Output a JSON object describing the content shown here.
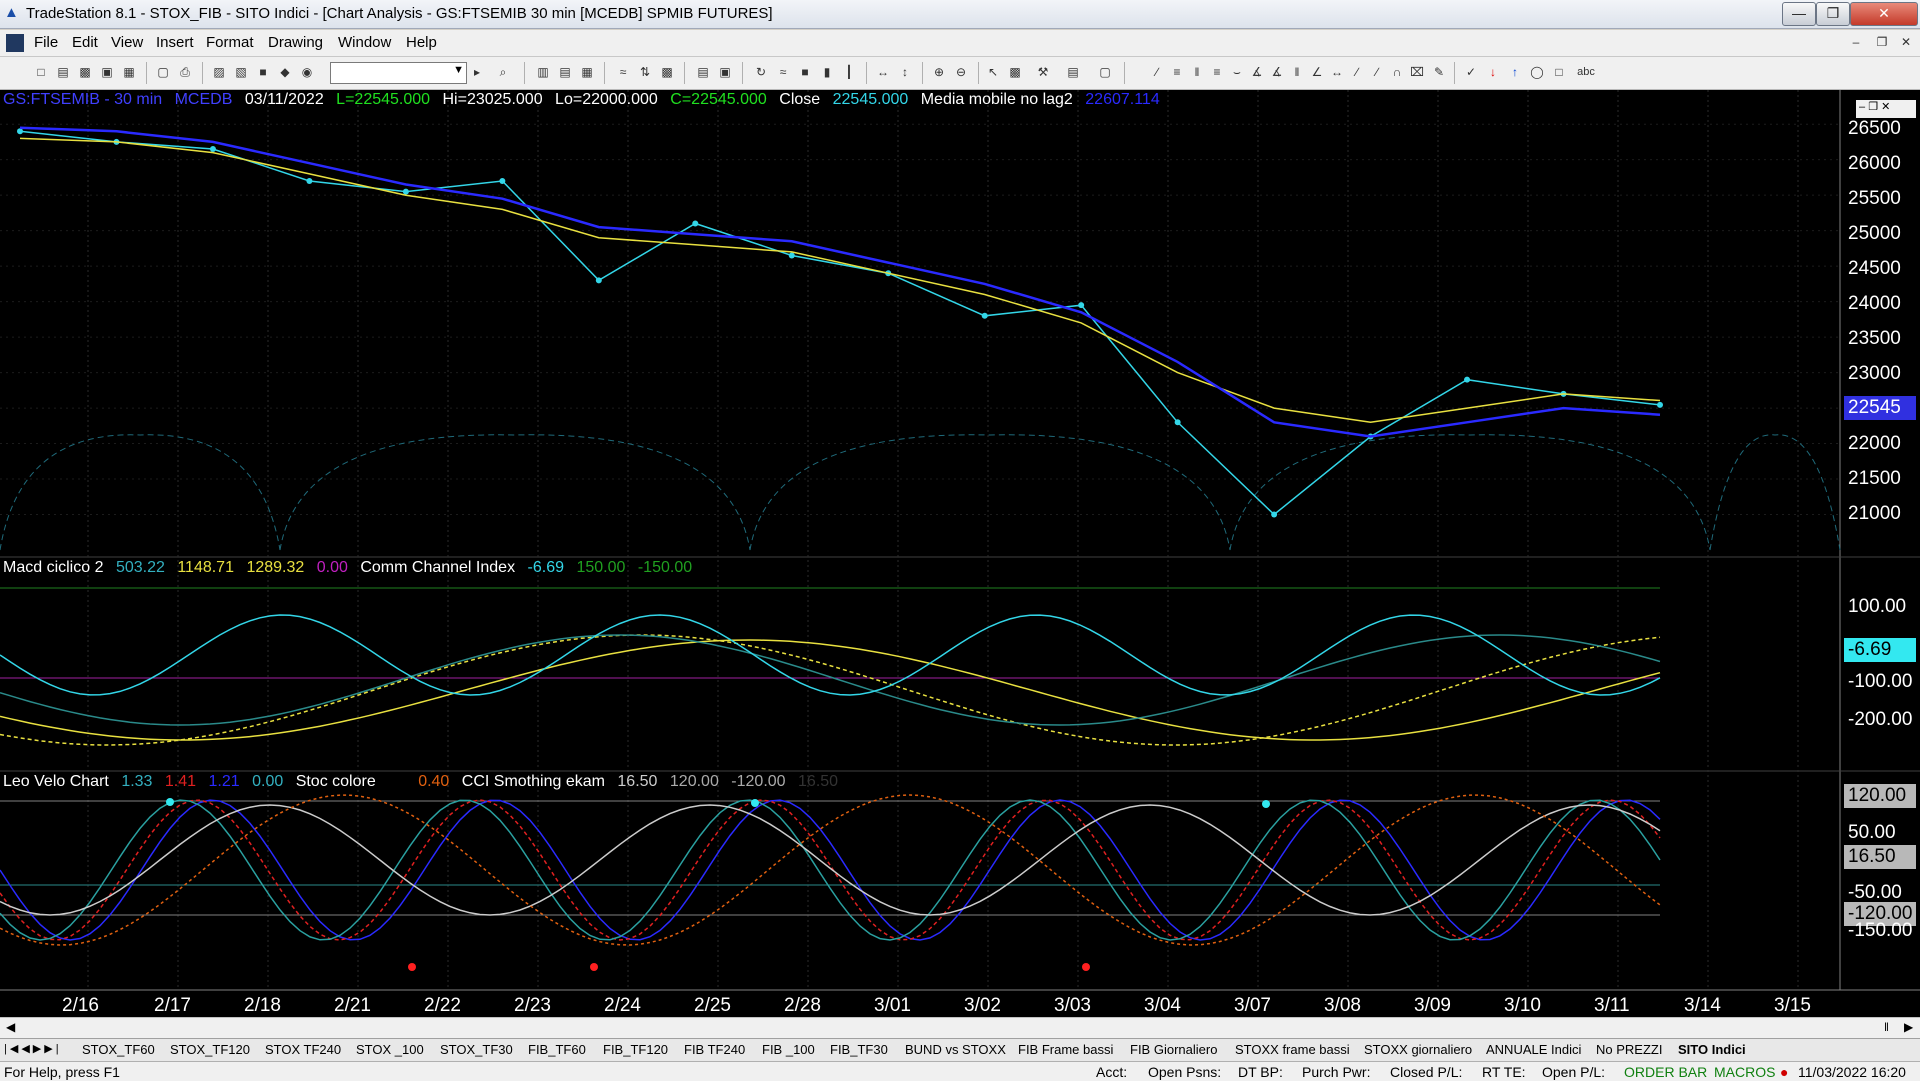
{
  "window": {
    "title": "TradeStation 8.1 - STOX_FIB - SITO Indici - [Chart Analysis - GS:FTSEMIB  30 min  [MCEDB] SPMIB FUTURES]"
  },
  "menu": [
    "File",
    "Edit",
    "View",
    "Insert",
    "Format",
    "Drawing",
    "Window",
    "Help"
  ],
  "toolbar": {
    "combo_value": ""
  },
  "price_legend": {
    "symbol": "GS:FTSEMIB - 30 min",
    "exchange": "MCEDB",
    "date": "03/11/2022",
    "last": "L=22545.000",
    "high": "Hi=23025.000",
    "low": "Lo=22000.000",
    "close": "C=22545.000",
    "close_label": "Close",
    "close_value": "22545.000",
    "ma_label": "Media mobile no lag2",
    "ma_value": "22607.114"
  },
  "macd_legend": {
    "name": "Macd ciclico 2",
    "v1": "503.22",
    "v2": "1148.71",
    "v3": "1289.32",
    "v4": "0.00",
    "cci_name": "Comm Channel Index",
    "cci_val": "-6.69",
    "cci_hi": "150.00",
    "cci_lo": "-150.00"
  },
  "velo_legend": {
    "name": "Leo Velo Chart",
    "v1": "1.33",
    "v2": "1.41",
    "v3": "1.21",
    "v4": "0.00",
    "stoc_name": "Stoc colore",
    "stoc_val": "0.40",
    "cci_smooth_name": "CCI Smothing ekam",
    "cs1": "16.50",
    "cs2": "120.00",
    "cs3": "-120.00",
    "cs4": "16.50"
  },
  "price_axis": [
    "26500",
    "26000",
    "25500",
    "25000",
    "24500",
    "24000",
    "23500",
    "23000",
    "22500",
    "22000",
    "21500",
    "21000"
  ],
  "price_tag": "22545",
  "macd_axis": [
    "100.00",
    "-100.00",
    "-200.00"
  ],
  "macd_tag": "-6.69",
  "velo_axis": [
    "50.00",
    "-50.00",
    "-150.00"
  ],
  "velo_tags": {
    "top": "120.00",
    "mid": "16.50",
    "bottom": "-120.00"
  },
  "dates": [
    "2/16",
    "2/17",
    "2/18",
    "2/21",
    "2/22",
    "2/23",
    "2/24",
    "2/25",
    "2/28",
    "3/01",
    "3/02",
    "3/03",
    "3/04",
    "3/07",
    "3/08",
    "3/09",
    "3/10",
    "3/11",
    "3/14",
    "3/15"
  ],
  "sheet_tabs": [
    "STOX_TF60",
    "STOX_TF120",
    "STOX TF240",
    "STOX _100",
    "STOX_TF30",
    "FIB_TF60",
    "FIB_TF120",
    "FIB TF240",
    "FIB _100",
    "FIB_TF30",
    "BUND vs STOXX",
    "FIB Frame bassi",
    "FIB Giornaliero",
    "STOXX frame bassi",
    "STOXX giornaliero",
    "ANNUALE Indici",
    "No PREZZI",
    "SITO Indici"
  ],
  "active_tab": "SITO Indici",
  "status": {
    "help": "For Help, press F1",
    "acct": "Acct:",
    "open_psns": "Open Psns:",
    "dt_bp": "DT BP:",
    "purch_pwr": "Purch Pwr:",
    "closed_pl": "Closed P/L:",
    "rt_te": "RT TE:",
    "open_pl": "Open P/L:",
    "order_bar": "ORDER BAR",
    "macros": "MACROS",
    "datetime": "11/03/2022 16:20"
  },
  "chart_data": {
    "type": "line",
    "title": "GS:FTSEMIB - 30 min",
    "x": [
      "2/16",
      "2/17",
      "2/18",
      "2/21",
      "2/22",
      "2/23",
      "2/24",
      "2/25",
      "2/28",
      "3/01",
      "3/02",
      "3/03",
      "3/04",
      "3/07",
      "3/08",
      "3/09",
      "3/10",
      "3/11"
    ],
    "series": [
      {
        "name": "Close",
        "values": [
          26400,
          26250,
          26150,
          25700,
          25550,
          25700,
          24300,
          25100,
          24650,
          24400,
          23800,
          23950,
          22300,
          21000,
          22100,
          22900,
          22700,
          22545
        ]
      },
      {
        "name": "Media mobile no lag2",
        "values": [
          26300,
          26250,
          26100,
          25800,
          25500,
          25300,
          24900,
          24800,
          24700,
          24400,
          24100,
          23700,
          23000,
          22500,
          22300,
          22500,
          22700,
          22607
        ]
      }
    ],
    "ylim": [
      20500,
      26700
    ]
  },
  "colors": {
    "price": "#33d6e8",
    "ma_blue": "#2a2aff",
    "ma_yellow": "#e8e040",
    "bg": "#000000"
  }
}
